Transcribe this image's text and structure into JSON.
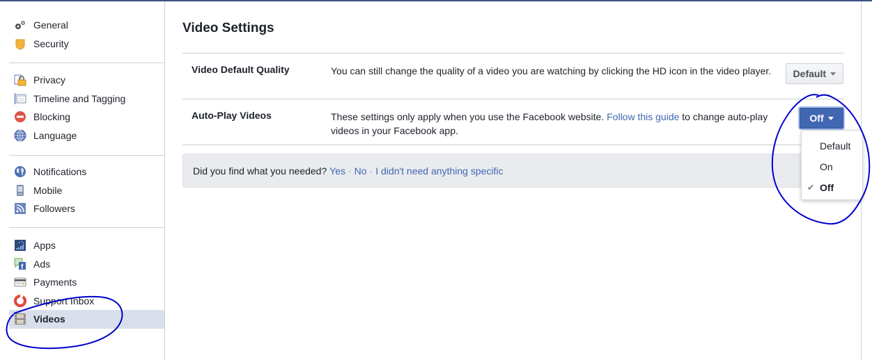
{
  "sidebar": {
    "groups": [
      [
        {
          "label": "General",
          "icon": "gears-icon"
        },
        {
          "label": "Security",
          "icon": "badge-icon"
        }
      ],
      [
        {
          "label": "Privacy",
          "icon": "lock-icon"
        },
        {
          "label": "Timeline and Tagging",
          "icon": "timeline-icon"
        },
        {
          "label": "Blocking",
          "icon": "blocking-icon"
        },
        {
          "label": "Language",
          "icon": "globe-icon"
        }
      ],
      [
        {
          "label": "Notifications",
          "icon": "earth-icon"
        },
        {
          "label": "Mobile",
          "icon": "mobile-icon"
        },
        {
          "label": "Followers",
          "icon": "rss-icon"
        }
      ],
      [
        {
          "label": "Apps",
          "icon": "apps-icon"
        },
        {
          "label": "Ads",
          "icon": "ads-icon"
        },
        {
          "label": "Payments",
          "icon": "credit-card-icon"
        },
        {
          "label": "Support Inbox",
          "icon": "lifebuoy-icon"
        },
        {
          "label": "Videos",
          "icon": "film-icon",
          "active": true
        }
      ]
    ]
  },
  "main": {
    "title": "Video Settings",
    "rows": [
      {
        "label": "Video Default Quality",
        "description": "You can still change the quality of a video you are watching by clicking the HD icon in the video player.",
        "value": "Default"
      },
      {
        "label": "Auto-Play Videos",
        "description_before": "These settings only apply when you use the Facebook website. ",
        "link": "Follow this guide",
        "description_after": " to change auto-play videos in your Facebook app.",
        "value": "Off"
      }
    ],
    "autoplay_menu": {
      "options": [
        "Default",
        "On",
        "Off"
      ],
      "selected": "Off"
    },
    "feedback": {
      "question": "Did you find what you needed?",
      "yes": "Yes",
      "no": "No",
      "other": "I didn't need anything specific",
      "separator": "·"
    }
  },
  "colors": {
    "accent": "#4267b2",
    "active_nav_bg": "#d8dfea",
    "annotation": "#0000cc"
  }
}
